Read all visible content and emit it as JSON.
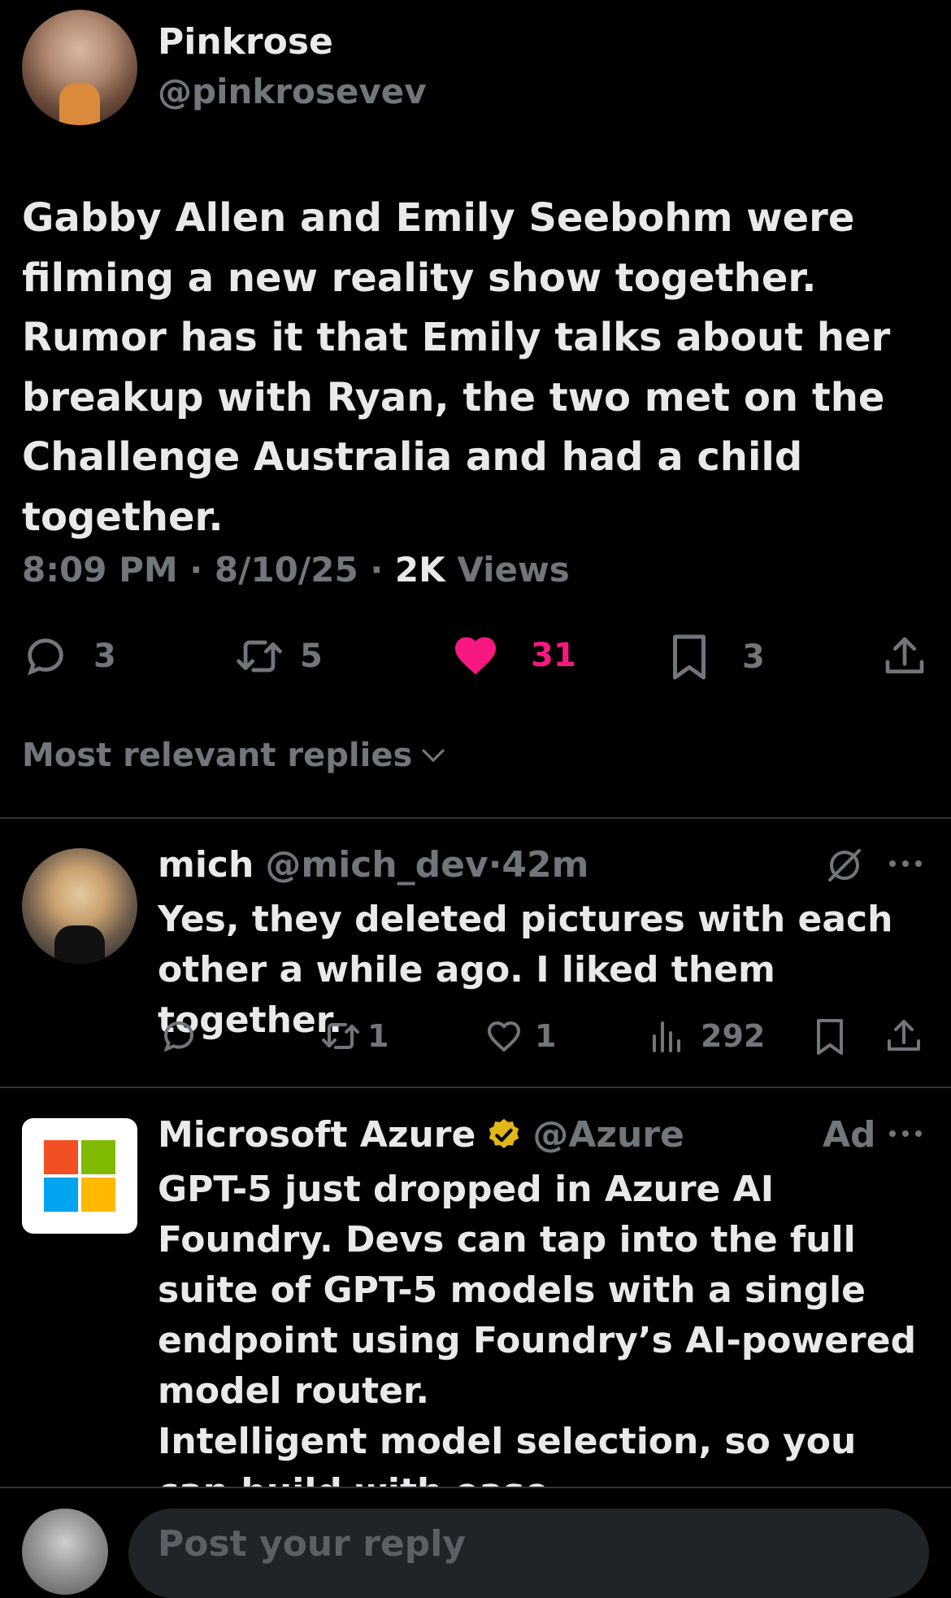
{
  "post": {
    "author_name": "Pinkrose",
    "author_handle": "@pinkrosevev",
    "text": "Gabby Allen and Emily Seebohm were filming a new reality show together. Rumor has it that Emily talks about her breakup with Ryan, the two met on the Challenge Australia and had a child together.",
    "time": "8:09 PM",
    "sep": "·",
    "date": "8/10/25",
    "views_count": "2K",
    "views_label": "Views",
    "stats": {
      "replies": "3",
      "reposts": "5",
      "likes": "31",
      "bookmarks": "3"
    },
    "like_color": "#f91880"
  },
  "sort": {
    "label": "Most relevant replies"
  },
  "reply": {
    "name": "mich",
    "handle": "@mich_dev",
    "sep": "·",
    "time": "42m",
    "text": "Yes, they deleted pictures with each other a while ago.  I liked them together.",
    "stats": {
      "reposts": "1",
      "likes": "1",
      "views": "292"
    }
  },
  "ad": {
    "name": "Microsoft Azure",
    "handle": "@Azure",
    "ad_label": "Ad",
    "text_1": "GPT-5 just dropped in Azure AI Foundry. Devs can tap into the full suite of GPT-5 models with a single endpoint using Foundry’s AI-powered model router.",
    "text_2": "Intelligent model selection, so you can build with ease.",
    "verified_color": "#e2b719",
    "logo_colors": [
      "#f25022",
      "#7fba00",
      "#00a4ef",
      "#ffb900"
    ]
  },
  "composer": {
    "placeholder": "Post your reply"
  }
}
